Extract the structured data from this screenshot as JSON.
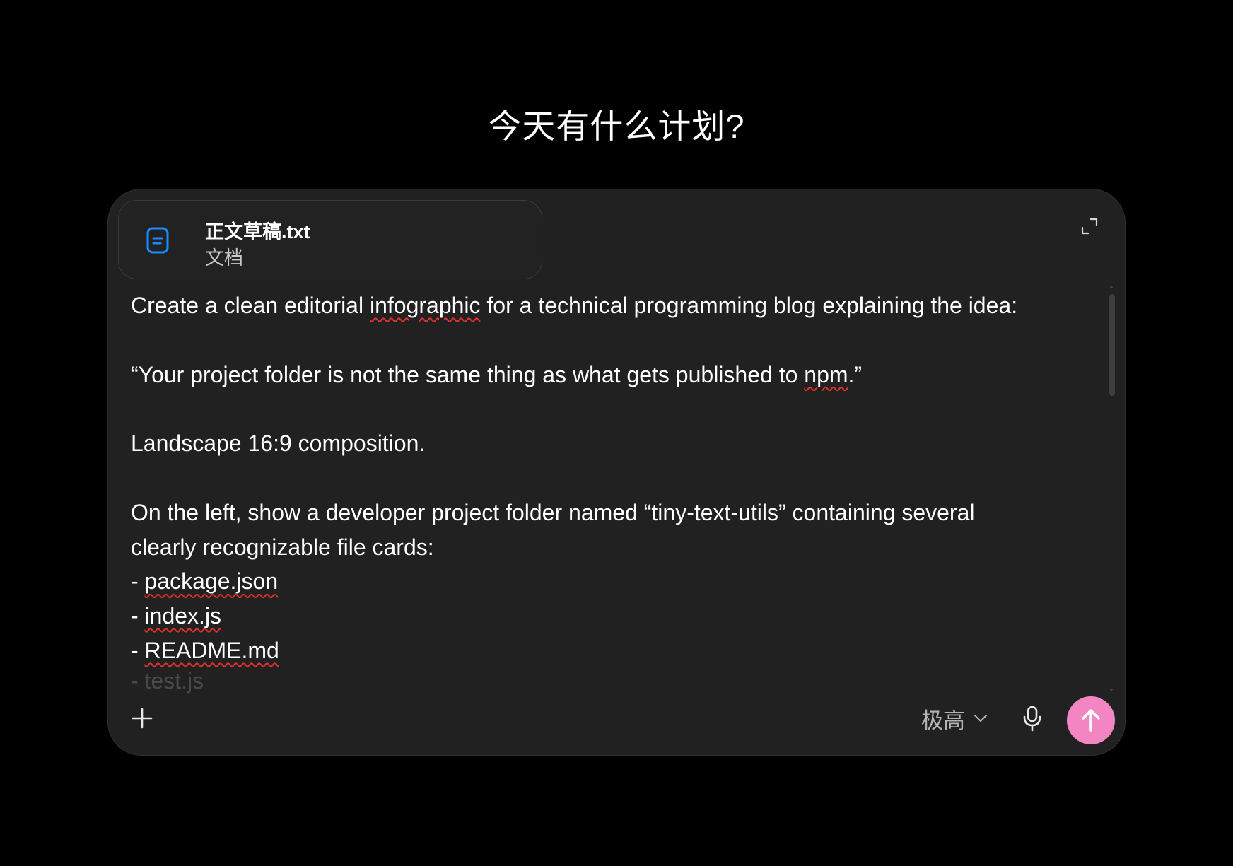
{
  "headline": "今天有什么计划?",
  "attachment": {
    "file_name": "正文草稿.txt",
    "file_type": "文档",
    "icon": "document-icon",
    "icon_color": "#1a8cff"
  },
  "prompt_lines": [
    "Create a clean editorial infographic for a technical programming blog explaining the idea:",
    "",
    "“Your project folder is not the same thing as what gets published to npm.”",
    "",
    "Landscape 16:9 composition.",
    "",
    "On the left, show a developer project folder named “tiny-text-utils” containing several",
    "clearly recognizable file cards:",
    "- package.json",
    "- index.js",
    "- README.md"
  ],
  "partially_visible_line": "- test.js",
  "toolbar": {
    "model_label": "极高",
    "plus_icon": "plus-icon",
    "chevron_icon": "chevron-down-icon",
    "mic_icon": "microphone-icon",
    "send_icon": "arrow-up-icon",
    "expand_icon": "expand-icon"
  },
  "colors": {
    "background": "#000000",
    "composer": "#212121",
    "send_button": "#f386c2",
    "spellcheck_underline": "#e03030"
  }
}
